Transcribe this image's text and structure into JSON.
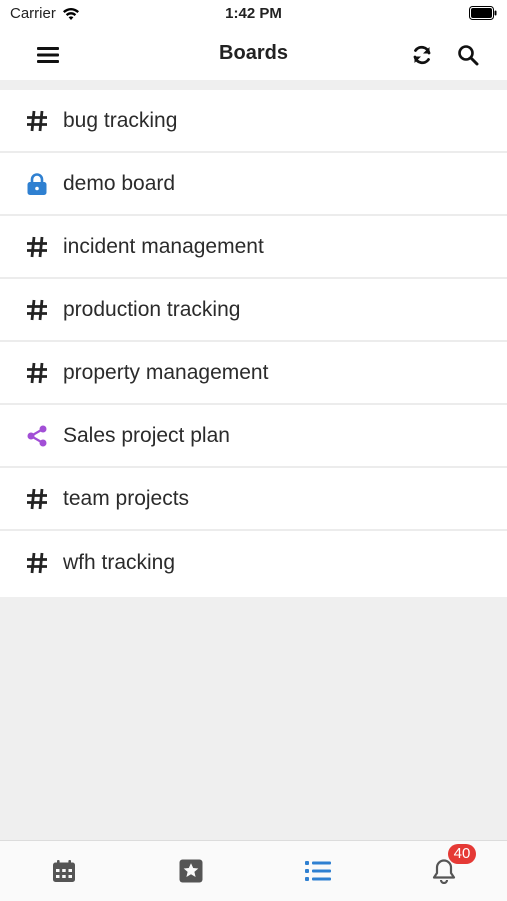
{
  "status_bar": {
    "carrier": "Carrier",
    "time": "1:42 PM"
  },
  "header": {
    "title": "Boards",
    "icons": [
      "hamburger-menu-icon",
      "refresh-icon",
      "search-icon"
    ]
  },
  "boards": [
    {
      "label": "bug tracking",
      "icon": "hash-icon"
    },
    {
      "label": "demo board",
      "icon": "lock-icon"
    },
    {
      "label": "incident management",
      "icon": "hash-icon"
    },
    {
      "label": "production tracking",
      "icon": "hash-icon"
    },
    {
      "label": "property management",
      "icon": "hash-icon"
    },
    {
      "label": "Sales project plan",
      "icon": "share-icon"
    },
    {
      "label": "team projects",
      "icon": "hash-icon"
    },
    {
      "label": "wfh tracking",
      "icon": "hash-icon"
    }
  ],
  "tab_bar": {
    "tabs": [
      "calendar-icon",
      "star-icon",
      "list-icon",
      "bell-icon"
    ],
    "active_tab": "list-icon",
    "notification_count": "40"
  },
  "colors": {
    "accent": "#2f80d1",
    "lock": "#2f80d1",
    "share": "#a24fd6",
    "badge": "#e53935",
    "text": "#2b2b2b",
    "background": "#efefef"
  }
}
